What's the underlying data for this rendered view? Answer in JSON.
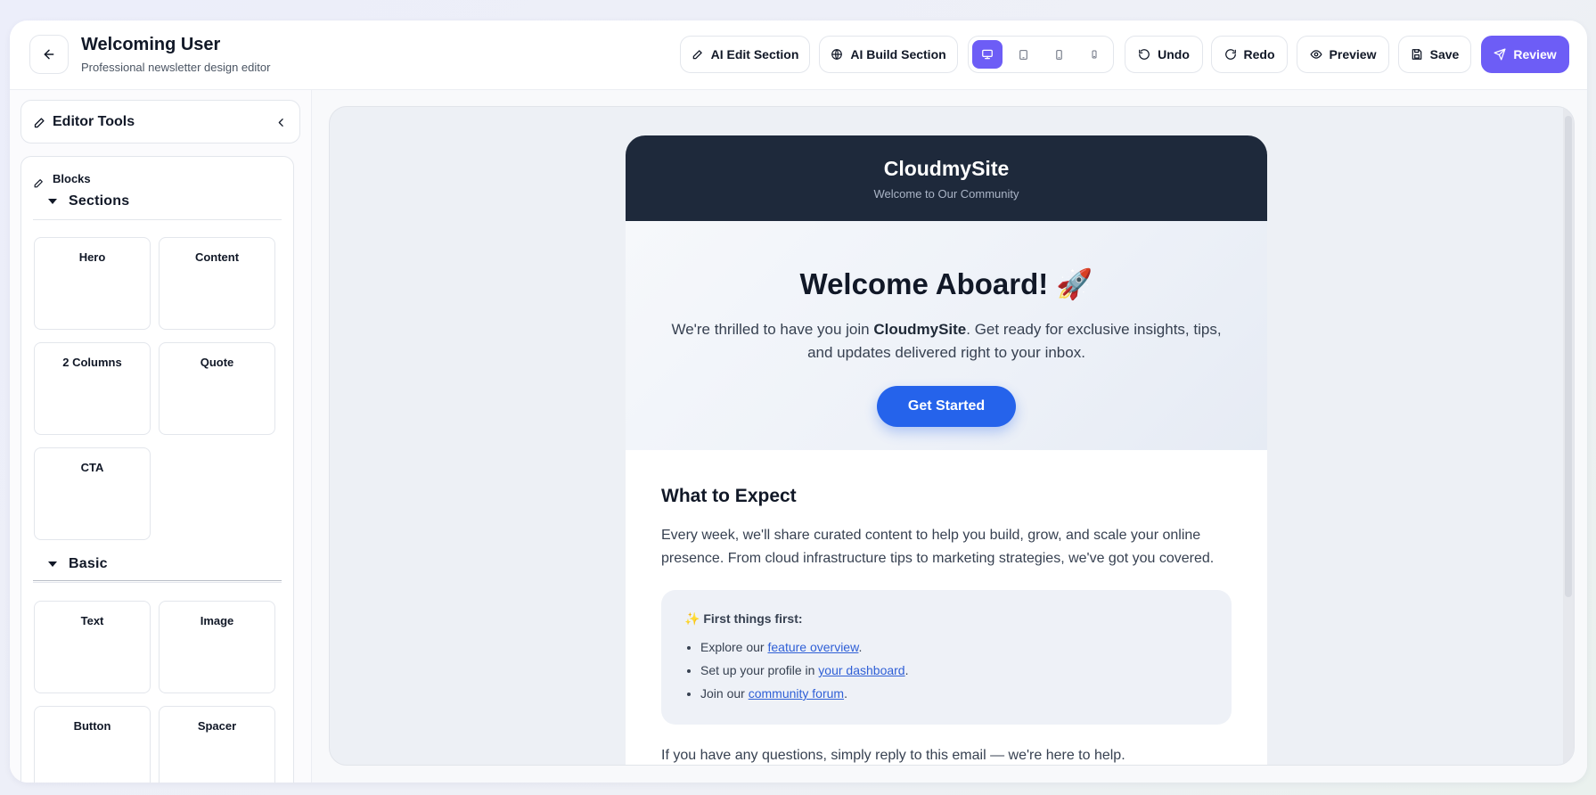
{
  "header": {
    "title": "Welcoming User",
    "subtitle": "Professional newsletter design editor",
    "ai_edit_label": "AI Edit Section",
    "ai_build_label": "AI Build Section",
    "undo_label": "Undo",
    "redo_label": "Redo",
    "preview_label": "Preview",
    "save_label": "Save",
    "review_label": "Review",
    "active_device": "desktop"
  },
  "sidebar": {
    "title": "Editor Tools",
    "blocks_title": "Blocks",
    "sections": {
      "label": "Sections",
      "items": [
        "Hero",
        "Content",
        "2 Columns",
        "Quote",
        "CTA"
      ]
    },
    "basic": {
      "label": "Basic",
      "items": [
        "Text",
        "Image",
        "Button",
        "Spacer"
      ]
    }
  },
  "email": {
    "brand": "CloudmySite",
    "tagline": "Welcome to Our Community",
    "hero": {
      "title": "Welcome Aboard! 🚀",
      "text_before": "We're thrilled to have you join ",
      "text_bold": "CloudmySite",
      "text_after": ". Get ready for exclusive insights, tips, and updates delivered right to your inbox.",
      "button_label": "Get Started"
    },
    "content": {
      "title": "What to Expect",
      "text": "Every week, we'll share curated content to help you build, grow, and scale your online presence. From cloud infrastructure tips to marketing strategies, we've got you covered.",
      "callout_title": "✨ First things first:",
      "items": [
        {
          "before": "Explore our ",
          "link": "feature overview",
          "after": "."
        },
        {
          "before": "Set up your profile in ",
          "link": "your dashboard",
          "after": "."
        },
        {
          "before": "Join our ",
          "link": "community forum",
          "after": "."
        }
      ],
      "outro": "If you have any questions, simply reply to this email — we're here to help."
    }
  },
  "colors": {
    "accent": "#6d5df6",
    "email_header_bg": "#1e293b",
    "cta_bg": "#2563eb",
    "link": "#2f5fd6"
  }
}
